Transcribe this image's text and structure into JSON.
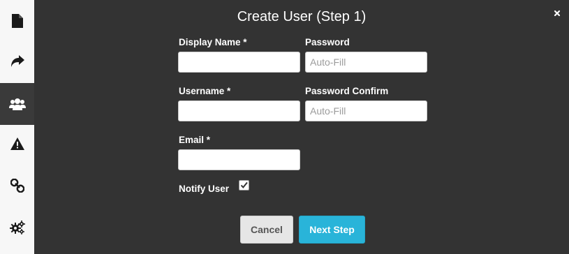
{
  "dialog": {
    "title": "Create User (Step 1)"
  },
  "sidebar": {
    "items": [
      {
        "icon": "file-icon"
      },
      {
        "icon": "share-arrow-icon"
      },
      {
        "icon": "users-icon",
        "active": true
      },
      {
        "icon": "warning-icon"
      },
      {
        "icon": "link-icon"
      },
      {
        "icon": "gears-icon"
      }
    ]
  },
  "form": {
    "display_name": {
      "label": "Display Name *",
      "value": "",
      "placeholder": ""
    },
    "password": {
      "label": "Password",
      "value": "",
      "placeholder": "Auto-Fill"
    },
    "username": {
      "label": "Username *",
      "value": "",
      "placeholder": ""
    },
    "password_confirm": {
      "label": "Password Confirm",
      "value": "",
      "placeholder": "Auto-Fill"
    },
    "email": {
      "label": "Email *",
      "value": "",
      "placeholder": ""
    },
    "notify_user": {
      "label": "Notify User",
      "checked": true
    }
  },
  "buttons": {
    "cancel": "Cancel",
    "next": "Next Step"
  },
  "colors": {
    "background": "#333333",
    "sidebar": "#f7f7f7",
    "primary": "#29b4d9",
    "cancel": "#e6e6e6"
  }
}
